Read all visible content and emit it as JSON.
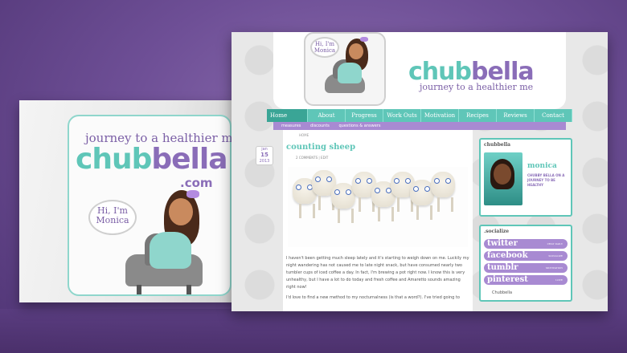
{
  "card": {
    "tagline": "journey to a healthier me",
    "logo_a": "chub",
    "logo_b": "bella",
    "logo_com": ".com",
    "bubble_line1": "Hi, I'm",
    "bubble_line2": "Monica"
  },
  "site": {
    "bubble_line1": "Hi, I'm",
    "bubble_line2": "Monica",
    "logo_a": "chub",
    "logo_b": "bella",
    "tagline": "journey to a healthier me",
    "nav": [
      "Home",
      "About",
      "Progress",
      "Work Outs",
      "Motivation",
      "Recipes",
      "Reviews",
      "Contact"
    ],
    "subnav": [
      "measures",
      "discounts",
      "questions & answers"
    ],
    "breadcrumb": "HOME",
    "date_month": "jan",
    "date_day": "15",
    "date_year": "2013",
    "post_title": "counting sheep",
    "post_meta": "2 COMMENTS  |  EDIT",
    "post_p1": "I haven't been getting much sleep lately and it's starting to weigh down on me. Luckily my night wandering has not caused me to late night snack, but have consumed nearly two tumbler cups of iced coffee a day. In fact, I'm brewing a pot right now. I know this is very unhealthy, but I have a lot to do today and fresh coffee and Amaretto sounds amazing right now!",
    "post_p2": "I'd love to find a new method to my nocturnalness (is that a word?). I've tried going to",
    "sidebar": {
      "about_title": "chubbella",
      "about_name": "monica",
      "about_desc": "CHUBBY BELLA ON A JOURNEY TO BE HEALTHY",
      "social_title": ".socialize",
      "social": [
        {
          "label": "twitter",
          "sub": "CHAT DAILY"
        },
        {
          "label": "facebook",
          "sub": "SOCIALIZE"
        },
        {
          "label": "tumblr",
          "sub": "MOTIVATION"
        },
        {
          "label": "pinterest",
          "sub": "LOVE"
        }
      ],
      "footer": "Chubbella"
    }
  },
  "colors": {
    "teal": "#5fc6b8",
    "purple": "#8a6db8",
    "background": "#6e4f96"
  }
}
